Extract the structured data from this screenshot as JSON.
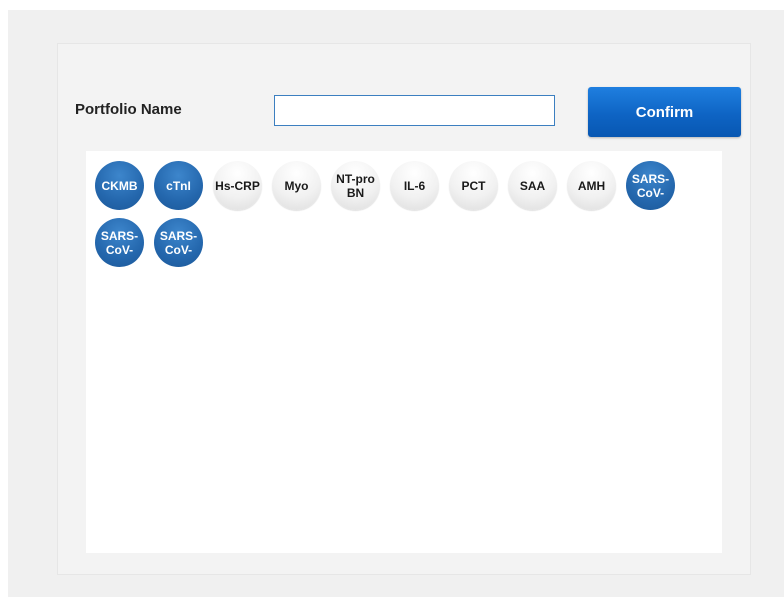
{
  "form": {
    "name_label": "Portfolio Name",
    "name_value": "",
    "confirm_label": "Confirm"
  },
  "colors": {
    "selected_chip": "#2467ad",
    "unselected_chip": "#f1f1f1",
    "confirm_button": "#0e64c4",
    "input_border": "#3c7fc0"
  },
  "chips": [
    {
      "label": "CKMB",
      "selected": true
    },
    {
      "label": "cTnI",
      "selected": true
    },
    {
      "label": "Hs-CRP",
      "selected": false
    },
    {
      "label": "Myo",
      "selected": false
    },
    {
      "label": "NT-proBN",
      "selected": false
    },
    {
      "label": "IL-6",
      "selected": false
    },
    {
      "label": "PCT",
      "selected": false
    },
    {
      "label": "SAA",
      "selected": false
    },
    {
      "label": "AMH",
      "selected": false
    },
    {
      "label": "SARS-CoV-",
      "selected": true
    },
    {
      "label": "SARS-CoV-",
      "selected": true
    },
    {
      "label": "SARS-CoV-",
      "selected": true
    }
  ]
}
